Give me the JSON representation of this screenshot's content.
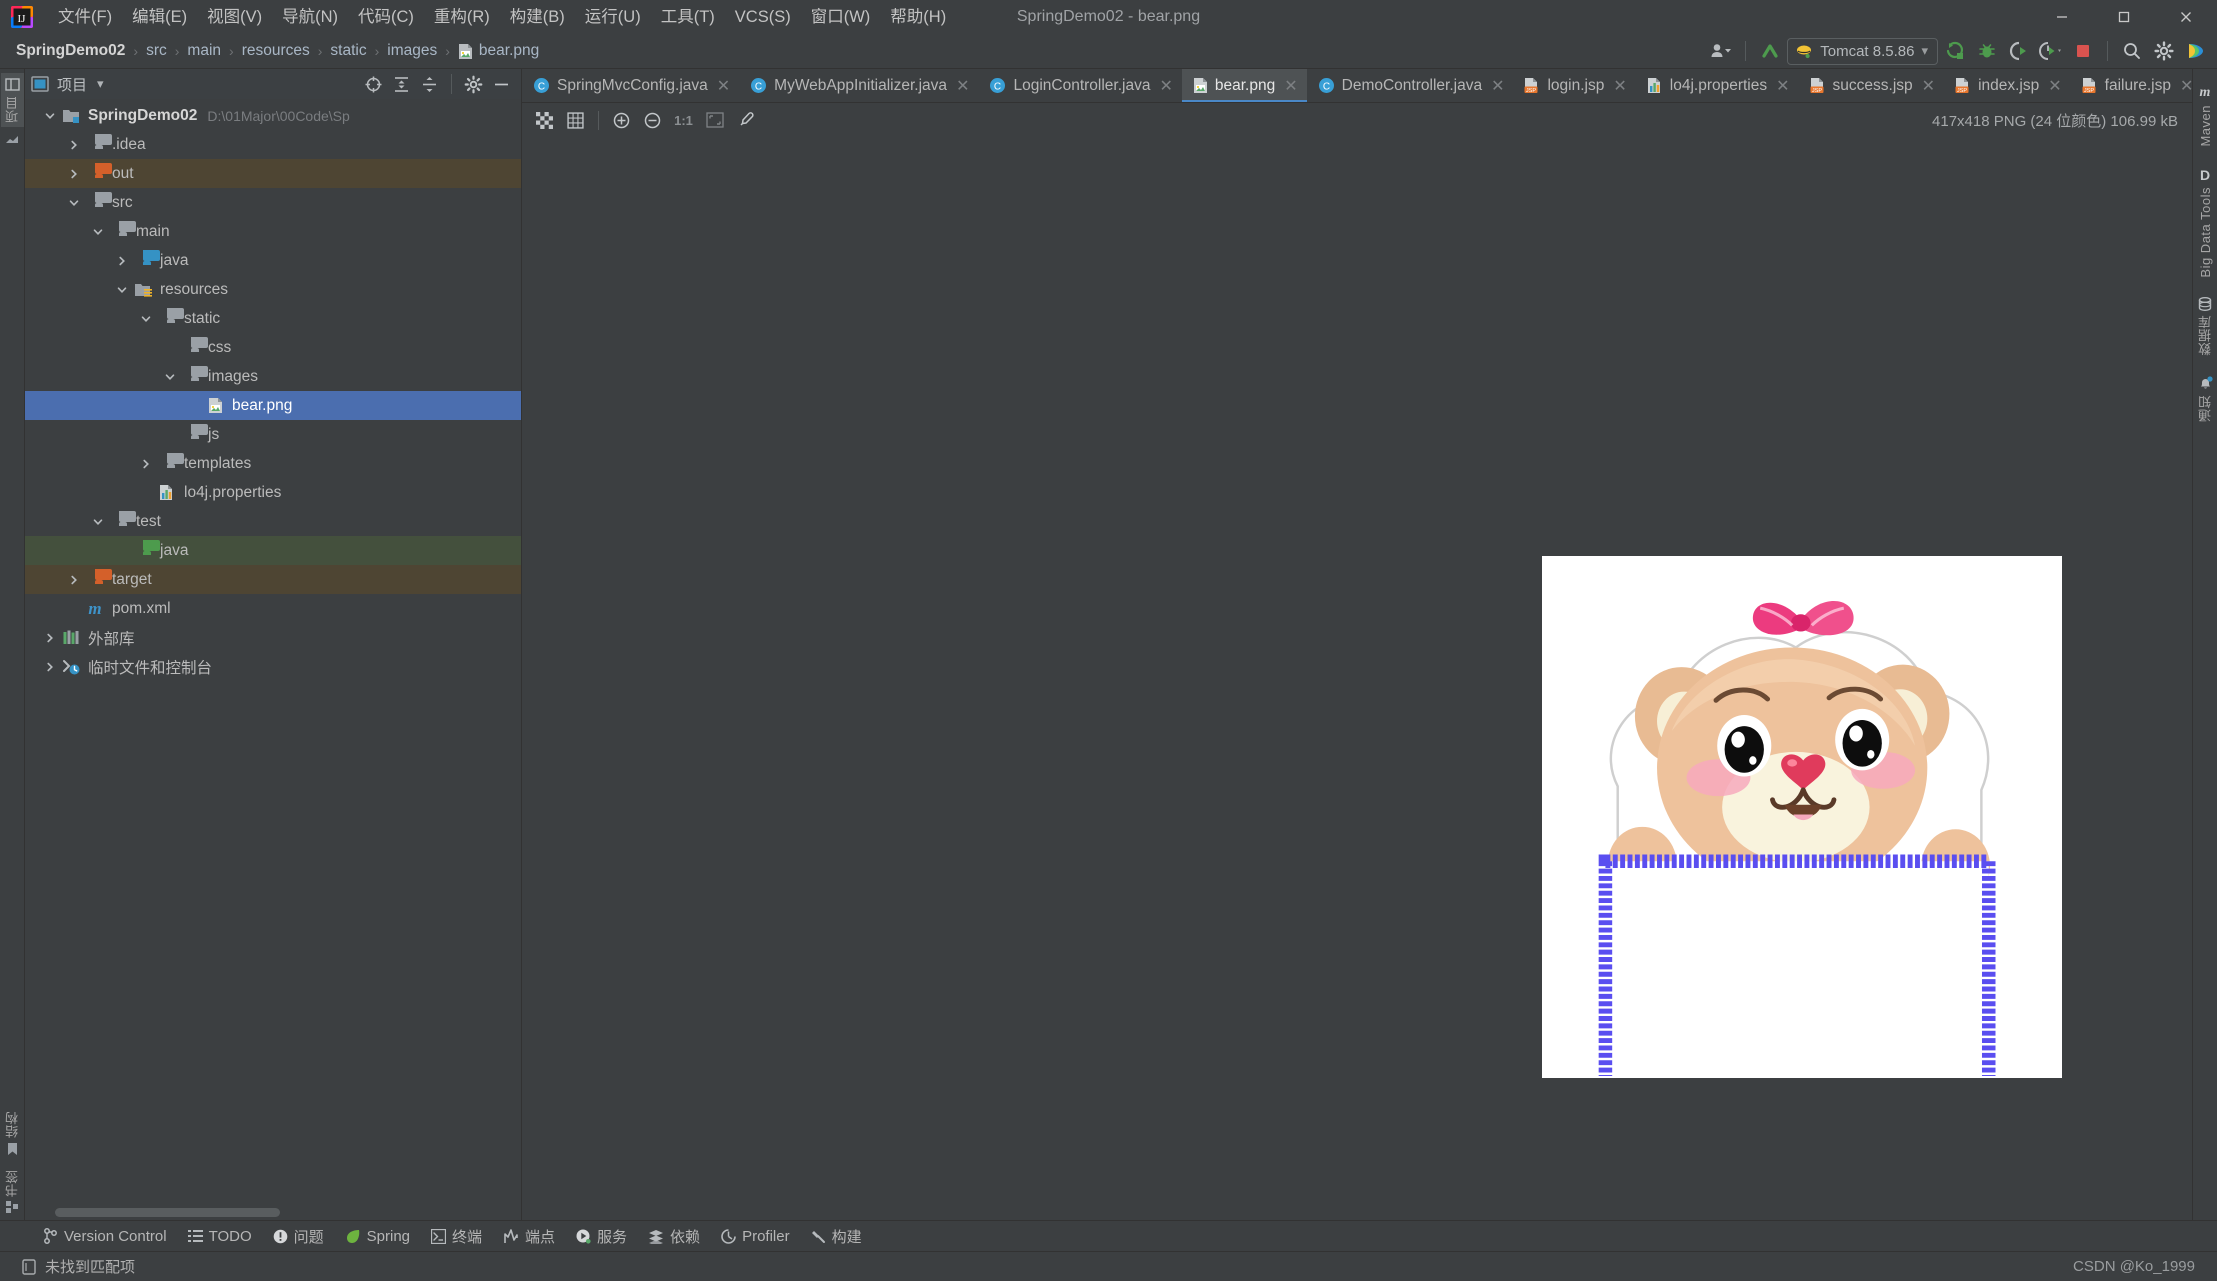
{
  "window": {
    "title": "SpringDemo02 - bear.png",
    "minimize": "—",
    "maximize": "▢",
    "close": "✕"
  },
  "menu": {
    "items": [
      {
        "label": "文件(F)",
        "name": "menu-file"
      },
      {
        "label": "编辑(E)",
        "name": "menu-edit"
      },
      {
        "label": "视图(V)",
        "name": "menu-view"
      },
      {
        "label": "导航(N)",
        "name": "menu-navigate"
      },
      {
        "label": "代码(C)",
        "name": "menu-code"
      },
      {
        "label": "重构(R)",
        "name": "menu-refactor"
      },
      {
        "label": "构建(B)",
        "name": "menu-build"
      },
      {
        "label": "运行(U)",
        "name": "menu-run"
      },
      {
        "label": "工具(T)",
        "name": "menu-tools"
      },
      {
        "label": "VCS(S)",
        "name": "menu-vcs"
      },
      {
        "label": "窗口(W)",
        "name": "menu-window"
      },
      {
        "label": "帮助(H)",
        "name": "menu-help"
      }
    ]
  },
  "navbar": {
    "crumbs": [
      "SpringDemo02",
      "src",
      "main",
      "resources",
      "static",
      "images",
      "bear.png"
    ],
    "separator": "›",
    "run_config": "Tomcat 8.5.86",
    "run_config_caret": "▾"
  },
  "project_panel": {
    "title": "项目",
    "caret": "▾",
    "tree": [
      {
        "depth": 0,
        "twist": "v",
        "icon": "folder-module",
        "label": "SpringDemo02",
        "bold": true,
        "path": "D:\\01Major\\00Code\\Sp",
        "state": "normal"
      },
      {
        "depth": 1,
        "twist": ">",
        "icon": "folder-gray",
        "label": ".idea",
        "state": "normal"
      },
      {
        "depth": 1,
        "twist": ">",
        "icon": "folder-orange",
        "label": "out",
        "state": "excluded"
      },
      {
        "depth": 1,
        "twist": "v",
        "icon": "folder-gray",
        "label": "src",
        "state": "normal"
      },
      {
        "depth": 2,
        "twist": "v",
        "icon": "folder-gray",
        "label": "main",
        "state": "normal"
      },
      {
        "depth": 3,
        "twist": ">",
        "icon": "folder-blue",
        "label": "java",
        "state": "normal"
      },
      {
        "depth": 3,
        "twist": "v",
        "icon": "folder-resources",
        "label": "resources",
        "state": "normal"
      },
      {
        "depth": 4,
        "twist": "v",
        "icon": "folder-gray",
        "label": "static",
        "state": "normal"
      },
      {
        "depth": 5,
        "twist": "",
        "icon": "folder-gray",
        "label": "css",
        "state": "normal"
      },
      {
        "depth": 5,
        "twist": "v",
        "icon": "folder-gray",
        "label": "images",
        "state": "normal"
      },
      {
        "depth": 6,
        "twist": "",
        "icon": "file-image",
        "label": "bear.png",
        "state": "selected"
      },
      {
        "depth": 5,
        "twist": "",
        "icon": "folder-gray",
        "label": "js",
        "state": "normal"
      },
      {
        "depth": 4,
        "twist": ">",
        "icon": "folder-gray",
        "label": "templates",
        "state": "normal"
      },
      {
        "depth": 4,
        "twist": "",
        "icon": "file-properties",
        "label": "lo4j.properties",
        "state": "normal"
      },
      {
        "depth": 2,
        "twist": "v",
        "icon": "folder-gray",
        "label": "test",
        "state": "normal"
      },
      {
        "depth": 3,
        "twist": "",
        "icon": "folder-green",
        "label": "java",
        "state": "test"
      },
      {
        "depth": 1,
        "twist": ">",
        "icon": "folder-orange",
        "label": "target",
        "state": "excluded"
      },
      {
        "depth": 1,
        "twist": "",
        "icon": "file-maven",
        "label": "pom.xml",
        "state": "normal"
      },
      {
        "depth": 0,
        "twist": ">",
        "icon": "library",
        "label": "外部库",
        "state": "normal"
      },
      {
        "depth": 0,
        "twist": ">",
        "icon": "scratches",
        "label": "临时文件和控制台",
        "state": "normal"
      }
    ]
  },
  "editor": {
    "tabs": [
      {
        "label": "SpringMvcConfig.java",
        "icon": "java-class-icon",
        "active": false
      },
      {
        "label": "MyWebAppInitializer.java",
        "icon": "java-class-icon",
        "active": false
      },
      {
        "label": "LoginController.java",
        "icon": "java-class-icon",
        "active": false
      },
      {
        "label": "bear.png",
        "icon": "image-file-icon",
        "active": true
      },
      {
        "label": "DemoController.java",
        "icon": "java-class-icon",
        "active": false
      },
      {
        "label": "login.jsp",
        "icon": "jsp-file-icon",
        "active": false
      },
      {
        "label": "lo4j.properties",
        "icon": "properties-file-icon",
        "active": false
      },
      {
        "label": "success.jsp",
        "icon": "jsp-file-icon",
        "active": false
      },
      {
        "label": "index.jsp",
        "icon": "jsp-file-icon",
        "active": false
      },
      {
        "label": "failure.jsp",
        "icon": "jsp-file-icon",
        "active": false
      }
    ],
    "tab_close": "✕",
    "image_toolbar": {
      "zoom_ratio_label": "1:1",
      "buttons": [
        "transparency-grid-icon",
        "pixel-grid-icon",
        "zoom-in-icon",
        "zoom-out-icon",
        "actual-size-icon",
        "fit-content-icon",
        "color-picker-icon"
      ]
    },
    "image_info": "417x418 PNG (24 位颜色) 106.99 kB"
  },
  "tool_windows": {
    "left_strip": [
      {
        "label": "项目"
      },
      {
        "label": "结构"
      },
      {
        "label": "书签"
      }
    ],
    "right_strip": [
      {
        "label": "Maven",
        "icon": "maven-icon"
      },
      {
        "label": "Big Data Tools",
        "icon": "bigdata-icon"
      },
      {
        "label": "数据库",
        "icon": "database-icon"
      },
      {
        "label": "通知",
        "icon": "notifications-icon"
      }
    ],
    "bottom": [
      {
        "label": "Version Control",
        "icon": "branch-icon"
      },
      {
        "label": "TODO",
        "icon": "list-icon"
      },
      {
        "label": "问题",
        "icon": "warning-icon"
      },
      {
        "label": "Spring",
        "icon": "spring-leaf-icon"
      },
      {
        "label": "终端",
        "icon": "terminal-icon"
      },
      {
        "label": "端点",
        "icon": "endpoints-icon"
      },
      {
        "label": "服务",
        "icon": "services-icon"
      },
      {
        "label": "依赖",
        "icon": "dependencies-icon"
      },
      {
        "label": "Profiler",
        "icon": "profiler-icon"
      },
      {
        "label": "构建",
        "icon": "build-hammer-icon"
      }
    ]
  },
  "status": {
    "message": "未找到匹配项",
    "watermark": "CSDN @Ko_1999"
  },
  "colors": {
    "background": "#3c3f41",
    "selection": "#4b6eaf",
    "accent": "#4a88c7",
    "excluded_row": "#4e4533",
    "test_row": "#44503d"
  },
  "image_preview": {
    "alt": "Cartoon teddy bear holding a blank sign with blue dashed border",
    "bear_body": "#e8bb93",
    "bear_light": "#f5efd8",
    "bow": "#ec3b7f",
    "sign_border": "#5a4ef0",
    "nose": "#e03b5c"
  }
}
